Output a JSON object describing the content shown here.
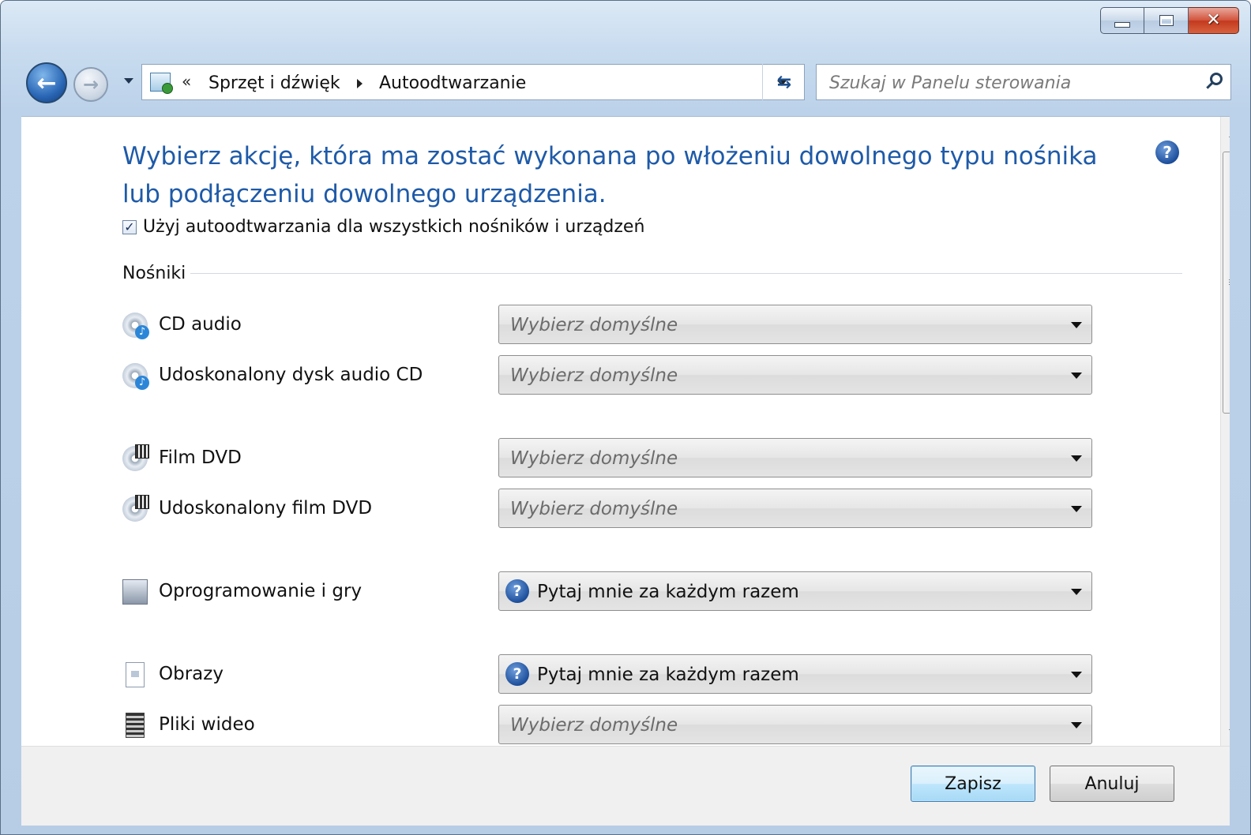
{
  "window": {
    "controls": {
      "minimize": "minimize-icon",
      "maximize": "maximize-icon",
      "close": "close-icon"
    }
  },
  "navigation": {
    "back_icon": "back-arrow-icon",
    "forward_icon": "forward-arrow-icon",
    "address": {
      "chevron": "«",
      "crumbs": [
        "Sprzęt i dźwięk",
        "Autoodtwarzanie"
      ]
    },
    "search": {
      "placeholder": "Szukaj w Panelu sterowania"
    }
  },
  "content": {
    "heading": "Wybierz akcję, która ma zostać wykonana po włożeniu dowolnego typu nośnika lub podłączeniu dowolnego urządzenia.",
    "use_autoplay_checkbox": {
      "label": "Użyj autoodtwarzania dla wszystkich nośników i urządzeń",
      "checked": true
    },
    "section_label": "Nośniki",
    "media": [
      {
        "name": "CD audio",
        "icon": "cd-audio-icon",
        "value": "Wybierz domyślne",
        "is_default": true
      },
      {
        "name": "Udoskonalony dysk audio CD",
        "icon": "enhanced-cd-audio-icon",
        "value": "Wybierz domyślne",
        "is_default": true
      },
      {
        "name": "Film DVD",
        "icon": "dvd-movie-icon",
        "value": "Wybierz domyślne",
        "is_default": true
      },
      {
        "name": "Udoskonalony film DVD",
        "icon": "enhanced-dvd-movie-icon",
        "value": "Wybierz domyślne",
        "is_default": true
      },
      {
        "name": "Oprogramowanie i gry",
        "icon": "software-games-icon",
        "value": "Pytaj mnie za każdym razem",
        "is_default": false
      },
      {
        "name": "Obrazy",
        "icon": "pictures-icon",
        "value": "Pytaj mnie za każdym razem",
        "is_default": false
      },
      {
        "name": "Pliki wideo",
        "icon": "video-files-icon",
        "value": "Wybierz domyślne",
        "is_default": true
      }
    ]
  },
  "footer": {
    "save": "Zapisz",
    "cancel": "Anuluj"
  }
}
